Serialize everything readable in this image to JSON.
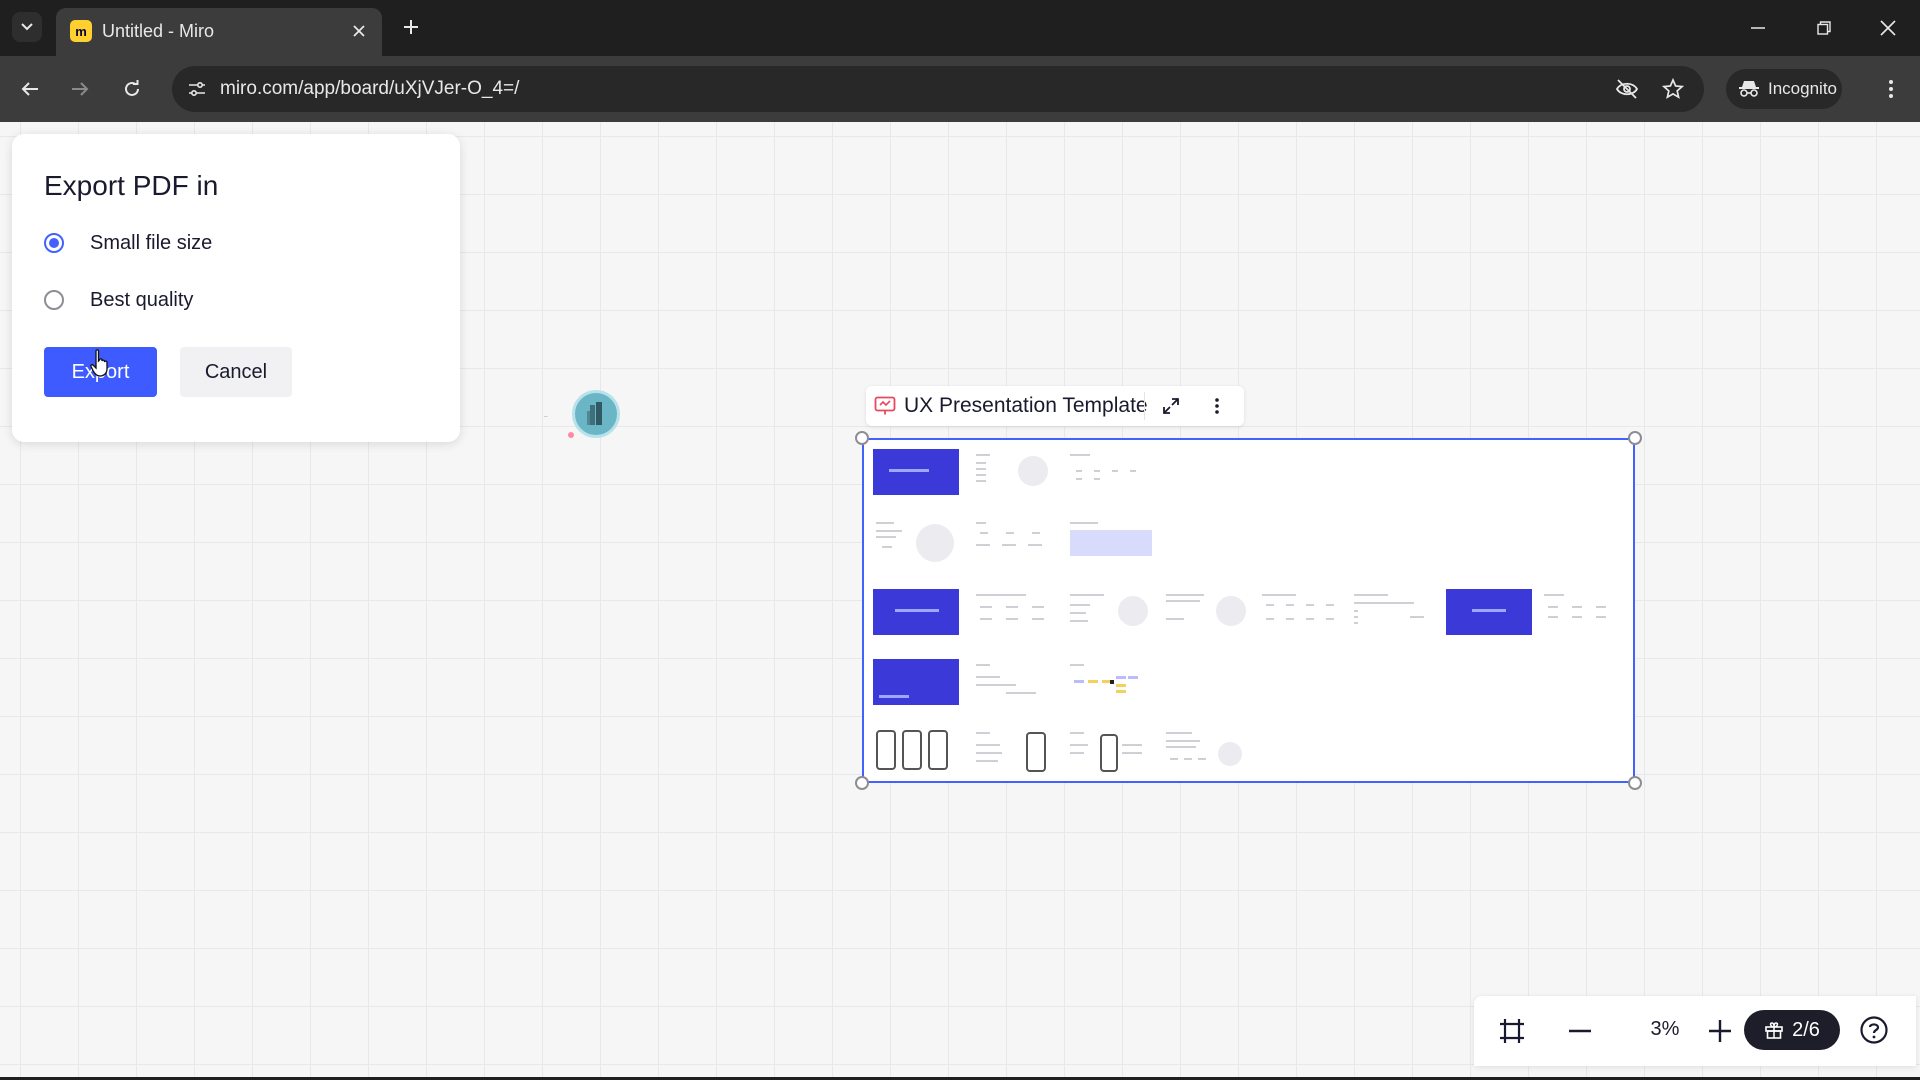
{
  "browser": {
    "tab_title": "Untitled - Miro",
    "url": "miro.com/app/board/uXjVJer-O_4=/",
    "incognito_label": "Incognito"
  },
  "export_dialog": {
    "title": "Export PDF in",
    "options": [
      {
        "label": "Small file size",
        "selected": true
      },
      {
        "label": "Best quality",
        "selected": false
      }
    ],
    "export_label": "Export",
    "cancel_label": "Cancel"
  },
  "frame": {
    "title": "UX Presentation Template"
  },
  "zoom_bar": {
    "zoom": "3%",
    "page_counter": "2/6"
  },
  "colors": {
    "accent": "#4262ff",
    "export_button": "#3e5bff",
    "slide_blue": "#3c39d9",
    "miro_yellow": "#ffd02f"
  },
  "icons": [
    "tab-list-icon",
    "miro-logo-icon",
    "close-icon",
    "plus-icon",
    "minimize-icon",
    "restore-icon",
    "window-close-icon",
    "back-icon",
    "forward-icon",
    "reload-icon",
    "site-info-icon",
    "eye-off-icon",
    "star-icon",
    "incognito-icon",
    "kebab-menu-icon",
    "presentation-icon",
    "expand-icon",
    "more-icon",
    "fit-screen-icon",
    "zoom-out-icon",
    "zoom-in-icon",
    "gift-icon",
    "help-icon",
    "pointer-cursor-icon"
  ]
}
